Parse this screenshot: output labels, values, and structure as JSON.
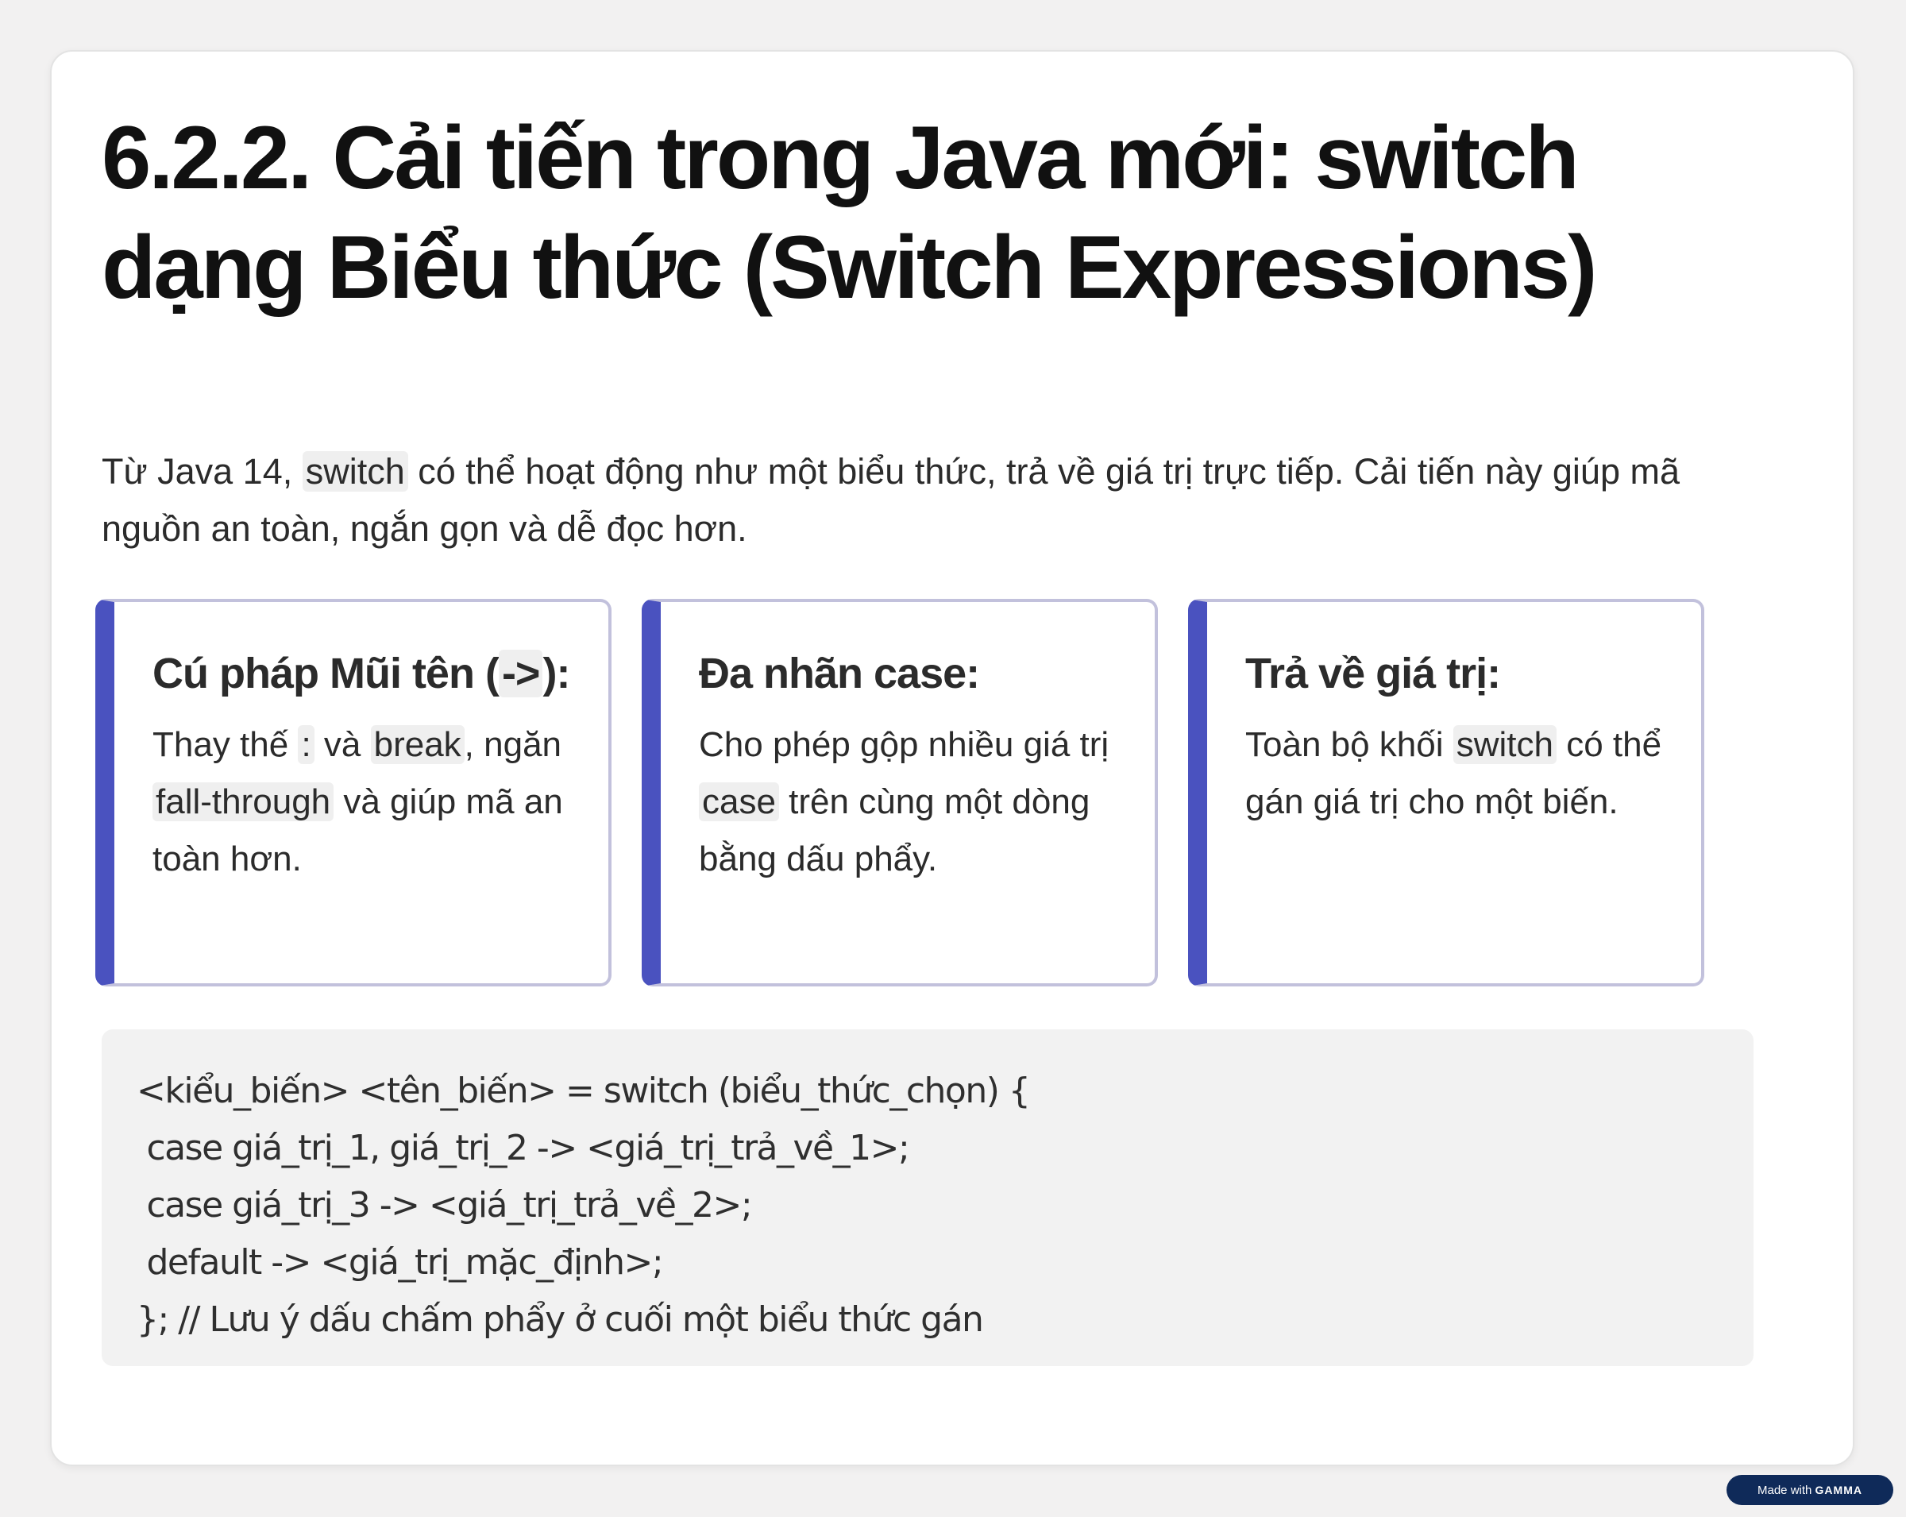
{
  "slide": {
    "title": "6.2.2. Cải tiến trong Java mới: switch dạng Biểu thức (Switch Expressions)",
    "intro": {
      "prefix": "Từ Java 14, ",
      "code": "switch",
      "suffix": " có thể hoạt động như một biểu thức, trả về giá trị trực tiếp. Cải tiến này giúp mã nguồn an toàn, ngắn gọn và dễ đọc hơn."
    },
    "cards": [
      {
        "title_pre": "Cú pháp Mũi tên (",
        "title_code": "->",
        "title_post": "):",
        "desc_pre": "Thay thế ",
        "desc_code1": ":",
        "desc_mid1": " và ",
        "desc_code2": "break",
        "desc_mid2": ", ngăn ",
        "desc_code3": "fall-through",
        "desc_post": " và giúp mã an toàn hơn."
      },
      {
        "title": "Đa nhãn case:",
        "desc_pre": "Cho phép gộp nhiều giá trị ",
        "desc_code": "case",
        "desc_post": " trên cùng một dòng bằng dấu phẩy."
      },
      {
        "title": "Trả về giá trị:",
        "desc_pre": "Toàn bộ khối ",
        "desc_code": "switch",
        "desc_post": " có thể gán giá trị cho một biến."
      }
    ],
    "code_lines": [
      "<kiểu_biến> <tên_biến> = switch (biểu_thức_chọn) {",
      " case giá_trị_1, giá_trị_2 -> <giá_trị_trả_về_1>;",
      " case giá_trị_3 -> <giá_trị_trả_về_2>;",
      " default -> <giá_trị_mặc_định>;",
      "}; // Lưu ý dấu chấm phẩy ở cuối một biểu thức gán"
    ]
  },
  "badge": {
    "made_with": "Made with",
    "brand": "GAMMA"
  },
  "colors": {
    "page_background": "#f2f1f1",
    "card_accent": "#4a52bf",
    "card_border": "#c2c1dc",
    "code_background": "#f2f2f2",
    "badge_background": "#0f2a59"
  }
}
